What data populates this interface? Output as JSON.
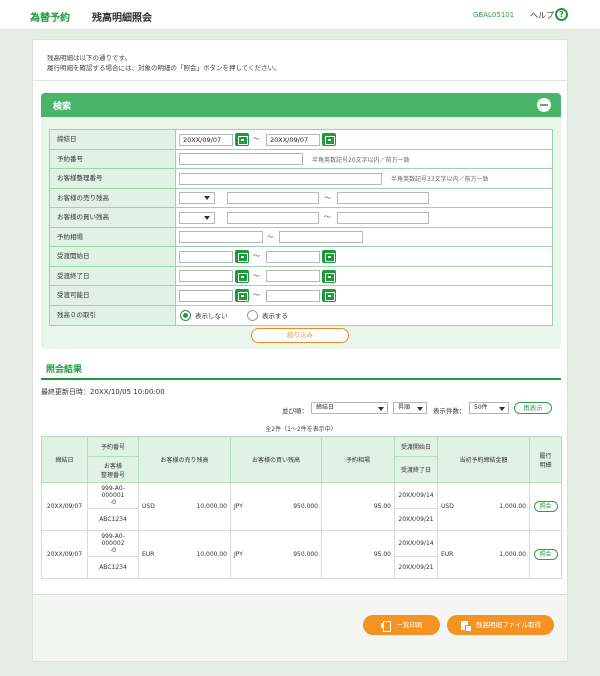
{
  "header": {
    "brand": "為替予約",
    "title": "残高明細照会",
    "screen_id": "GBAL05101",
    "help": "ヘルプ",
    "help_icon": "?"
  },
  "intro": {
    "line1": "残高明細は以下の通りです。",
    "line2": "履行明細を確認する場合には、対象の明細の「照会」ボタンを押してください。"
  },
  "search": {
    "title": "検索",
    "fields": {
      "contract_date": {
        "label": "締結日",
        "from": "20XX/09/07",
        "to": "20XX/09/07"
      },
      "reservation_no": {
        "label": "予約番号",
        "hint": "半角英数記号20文字以内／前方一致"
      },
      "customer_ref": {
        "label": "お客様整理番号",
        "hint": "半角英数記号33文字以内／前方一致"
      },
      "sell_balance": {
        "label": "お客様の売り残高"
      },
      "buy_balance": {
        "label": "お客様の買い残高"
      },
      "rate": {
        "label": "予約相場"
      },
      "delivery_start": {
        "label": "受渡開始日"
      },
      "delivery_end": {
        "label": "受渡終了日"
      },
      "delivery_possible": {
        "label": "受渡可能日"
      },
      "zero_balance": {
        "label": "残高０の取引",
        "options": [
          "表示しない",
          "表示する"
        ],
        "selected": "表示しない"
      }
    },
    "tilde": "～",
    "filter_button": "絞り込み"
  },
  "results": {
    "title": "照会結果",
    "updated": "最終更新日時：20XX/10/05 10:00:00",
    "sort_label": "並び順：",
    "sort_value": "締結日",
    "order_value": "昇順",
    "count_label": "表示件数：",
    "count_value": "50件",
    "redisplay_button": "再表示",
    "total": "全2件（1～2件を表示中）",
    "headers": {
      "contract_date": "締結日",
      "reservation_no": "予約番号",
      "customer_ref": "お客様\n整理番号",
      "sell_balance": "お客様の売り残高",
      "buy_balance": "お客様の買い残高",
      "rate": "予約相場",
      "delivery_start": "受渡開始日",
      "delivery_end": "受渡終了日",
      "performance_amount": "当初予約締結金額",
      "performance_detail": "履行\n明細"
    },
    "rows": [
      {
        "contract_date": "20XX/09/07",
        "reservation_no": "999-A0-000001\n-0",
        "customer_ref": "ABC1234",
        "sell_ccy": "USD",
        "sell_amount": "10,000.00",
        "buy_ccy": "JPY",
        "buy_amount": "950,000",
        "rate": "95.00",
        "delivery_start": "20XX/09/14",
        "delivery_end": "20XX/09/21",
        "amount_ccy": "USD",
        "amount": "1,000.00",
        "inquiry": "照会"
      },
      {
        "contract_date": "20XX/09/07",
        "reservation_no": "999-A0-000002\n-0",
        "customer_ref": "ABC1234",
        "sell_ccy": "EUR",
        "sell_amount": "10,000.00",
        "buy_ccy": "JPY",
        "buy_amount": "950,000",
        "rate": "95.00",
        "delivery_start": "20XX/09/14",
        "delivery_end": "20XX/09/21",
        "amount_ccy": "EUR",
        "amount": "1,000.00",
        "inquiry": "照会"
      }
    ]
  },
  "footer": {
    "print_button": "一覧印刷",
    "file_button": "残高明細ファイル取得"
  }
}
